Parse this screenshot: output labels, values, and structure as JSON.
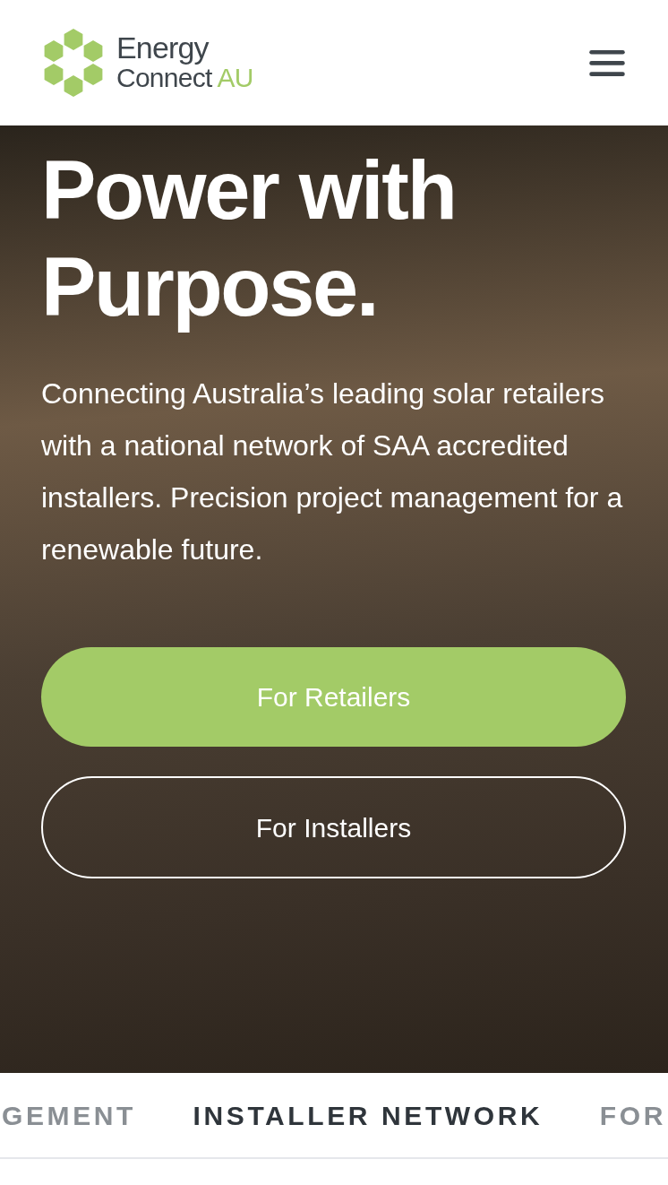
{
  "header": {
    "logo": {
      "line_1": "Energy",
      "line_2": "Connect",
      "line_2_accent": "AU"
    }
  },
  "hero": {
    "heading_lines": [
      "Power with",
      "Purpose."
    ],
    "description": "Connecting Australia’s leading solar retailers with a national network of SAA accredited installers. Precision project management for a renewable future.",
    "buttons": [
      {
        "label": "For Retailers",
        "kind": "filled"
      },
      {
        "label": "For Installers",
        "kind": "outline"
      }
    ]
  },
  "ticker": [
    "GEMENT",
    "INSTALLER NETWORK",
    "FOR"
  ]
}
